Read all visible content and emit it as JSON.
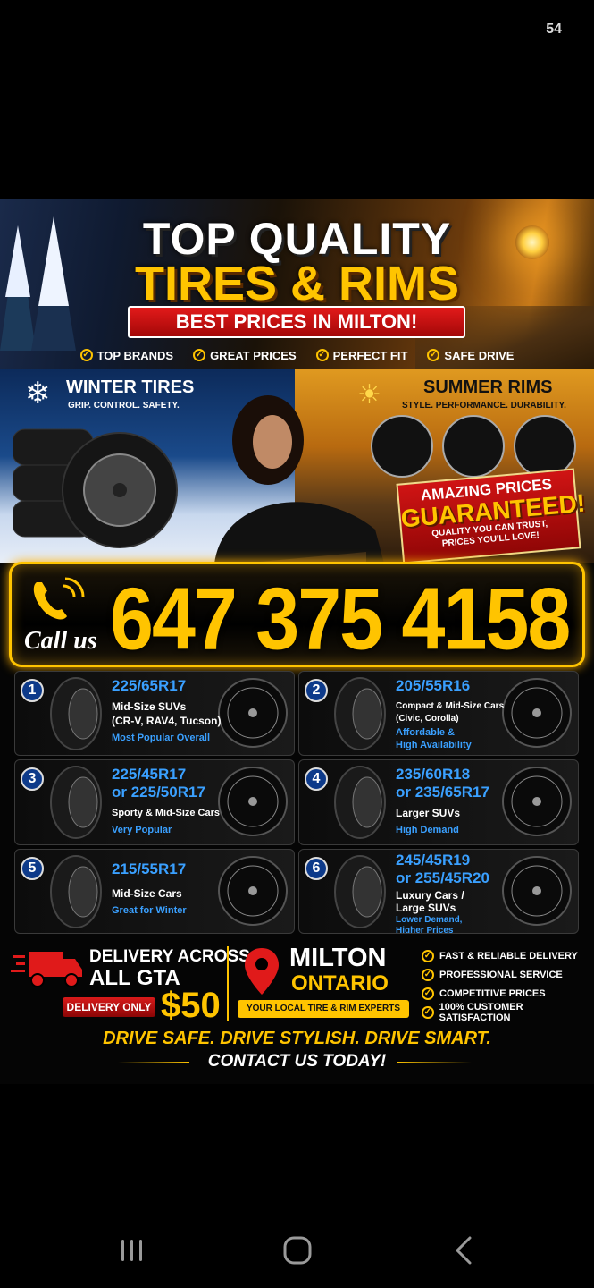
{
  "status_bar": {
    "time": "54"
  },
  "poster": {
    "headline_line1": "TOP QUALITY",
    "headline_line2": "TIRES & RIMS",
    "banner": "BEST PRICES IN MILTON!",
    "checks": [
      "TOP BRANDS",
      "GREAT PRICES",
      "PERFECT FIT",
      "SAFE DRIVE"
    ],
    "winter": {
      "title": "WINTER TIRES",
      "subtitle": "GRIP. CONTROL. SAFETY."
    },
    "summer": {
      "title": "SUMMER RIMS",
      "subtitle": "STYLE. PERFORMANCE. DURABILITY."
    },
    "promo": {
      "line1": "AMAZING PRICES",
      "line2": "GUARANTEED!",
      "line3": "QUALITY YOU CAN TRUST,",
      "line4": "PRICES YOU'LL LOVE!"
    },
    "call_label": "Call us",
    "phone": "647 375 4158",
    "items": [
      {
        "number": "1",
        "size": "225/65R17",
        "size2": "",
        "desc": [
          "Mid-Size SUVs",
          "(CR-V, RAV4, Tucson)"
        ],
        "tag": [
          "Most Popular Overall"
        ]
      },
      {
        "number": "2",
        "size": "205/55R16",
        "size2": "",
        "desc": [
          "Compact & Mid-Size Cars",
          "(Civic, Corolla)"
        ],
        "tag": [
          "Affordable &",
          "High Availability"
        ]
      },
      {
        "number": "3",
        "size": "225/45R17",
        "size2": "or 225/50R17",
        "desc": [
          "Sporty & Mid-Size Cars"
        ],
        "tag": [
          "Very Popular"
        ]
      },
      {
        "number": "4",
        "size": "235/60R18",
        "size2": "or 235/65R17",
        "desc": [
          "Larger SUVs"
        ],
        "tag": [
          "High Demand"
        ]
      },
      {
        "number": "5",
        "size": "215/55R17",
        "size2": "",
        "desc": [
          "Mid-Size Cars"
        ],
        "tag": [
          "Great for Winter"
        ]
      },
      {
        "number": "6",
        "size": "245/45R19",
        "size2": "or 255/45R20",
        "desc": [
          "Luxury Cars /",
          "Large SUVs"
        ],
        "tag": [
          "Lower Demand,",
          "Higher Prices"
        ]
      }
    ],
    "delivery": {
      "line1": "DELIVERY ACROSS",
      "line2": "ALL GTA",
      "badge": "DELIVERY ONLY",
      "price": "$50"
    },
    "location": {
      "city": "MILTON",
      "province": "ONTARIO",
      "tagline": "YOUR LOCAL TIRE & RIM EXPERTS"
    },
    "features": [
      "FAST & RELIABLE DELIVERY",
      "PROFESSIONAL SERVICE",
      "COMPETITIVE PRICES",
      "100% CUSTOMER SATISFACTION"
    ],
    "slogan": "DRIVE SAFE. DRIVE STYLISH. DRIVE SMART.",
    "cta": "CONTACT US TODAY!"
  },
  "nav": {
    "buttons": [
      "recent-apps-icon",
      "home-icon",
      "back-icon"
    ]
  },
  "colors": {
    "accent": "#ffc400",
    "red": "#d01414",
    "blue": "#3aa0ff"
  }
}
